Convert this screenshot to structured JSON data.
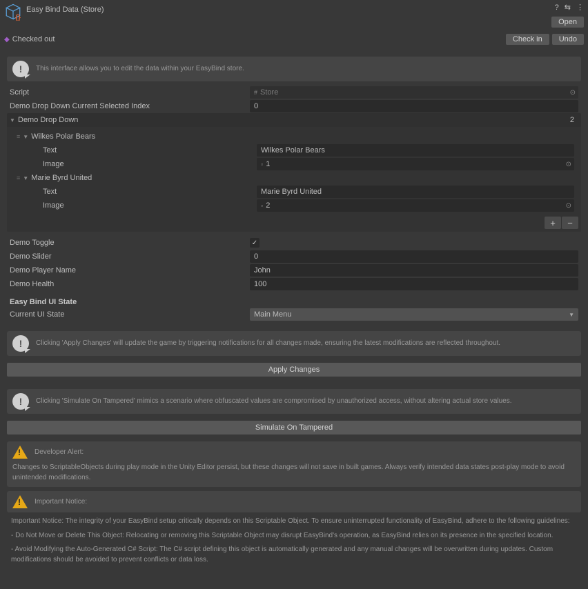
{
  "header": {
    "title": "Easy Bind Data (Store)",
    "open_btn": "Open",
    "checked_out": "Checked out",
    "checkin_btn": "Check in",
    "undo_btn": "Undo"
  },
  "info1": "This interface allows you to edit the data within your EasyBind store.",
  "script_label": "Script",
  "script_value": "Store",
  "ddidx_label": "Demo Drop Down Current Selected Index",
  "ddidx_value": "0",
  "dd_label": "Demo Drop Down",
  "dd_count": "2",
  "items": [
    {
      "name": "Wilkes Polar Bears",
      "text_label": "Text",
      "text_value": "Wilkes Polar Bears",
      "image_label": "Image",
      "image_value": "1"
    },
    {
      "name": "Marie Byrd United",
      "text_label": "Text",
      "text_value": "Marie Byrd United",
      "image_label": "Image",
      "image_value": "2"
    }
  ],
  "toggle_label": "Demo Toggle",
  "slider_label": "Demo Slider",
  "slider_value": "0",
  "player_label": "Demo Player Name",
  "player_value": "John",
  "health_label": "Demo Health",
  "health_value": "100",
  "section_state": "Easy Bind UI State",
  "state_label": "Current UI State",
  "state_value": "Main Menu",
  "info_apply": "Clicking 'Apply Changes' will update the game by triggering notifications for all changes made, ensuring the latest modifications are reflected throughout.",
  "btn_apply": "Apply Changes",
  "info_sim": "Clicking 'Simulate On Tampered' mimics a scenario where obfuscated values are compromised by unauthorized access, without altering actual store values.",
  "btn_sim": "Simulate On Tampered",
  "dev_alert_title": "Developer Alert:",
  "dev_alert_body": "Changes to ScriptableObjects during play mode in the Unity Editor persist, but these changes will not save in built games. Always verify intended data states post-play mode to avoid unintended modifications.",
  "notice_title": "Important Notice:",
  "notice_p1": "Important Notice: The integrity of your EasyBind setup critically depends on this Scriptable Object. To ensure uninterrupted functionality of EasyBind, adhere to the following guidelines:",
  "notice_p2": "- Do Not Move or Delete This Object: Relocating or removing this Scriptable Object may disrupt EasyBind's operation, as EasyBind relies on its presence in the specified location.",
  "notice_p3": "- Avoid Modifying the Auto-Generated C# Script: The C# script defining this object is automatically generated and any manual changes will be overwritten during updates. Custom modifications should be avoided to prevent conflicts or data loss."
}
